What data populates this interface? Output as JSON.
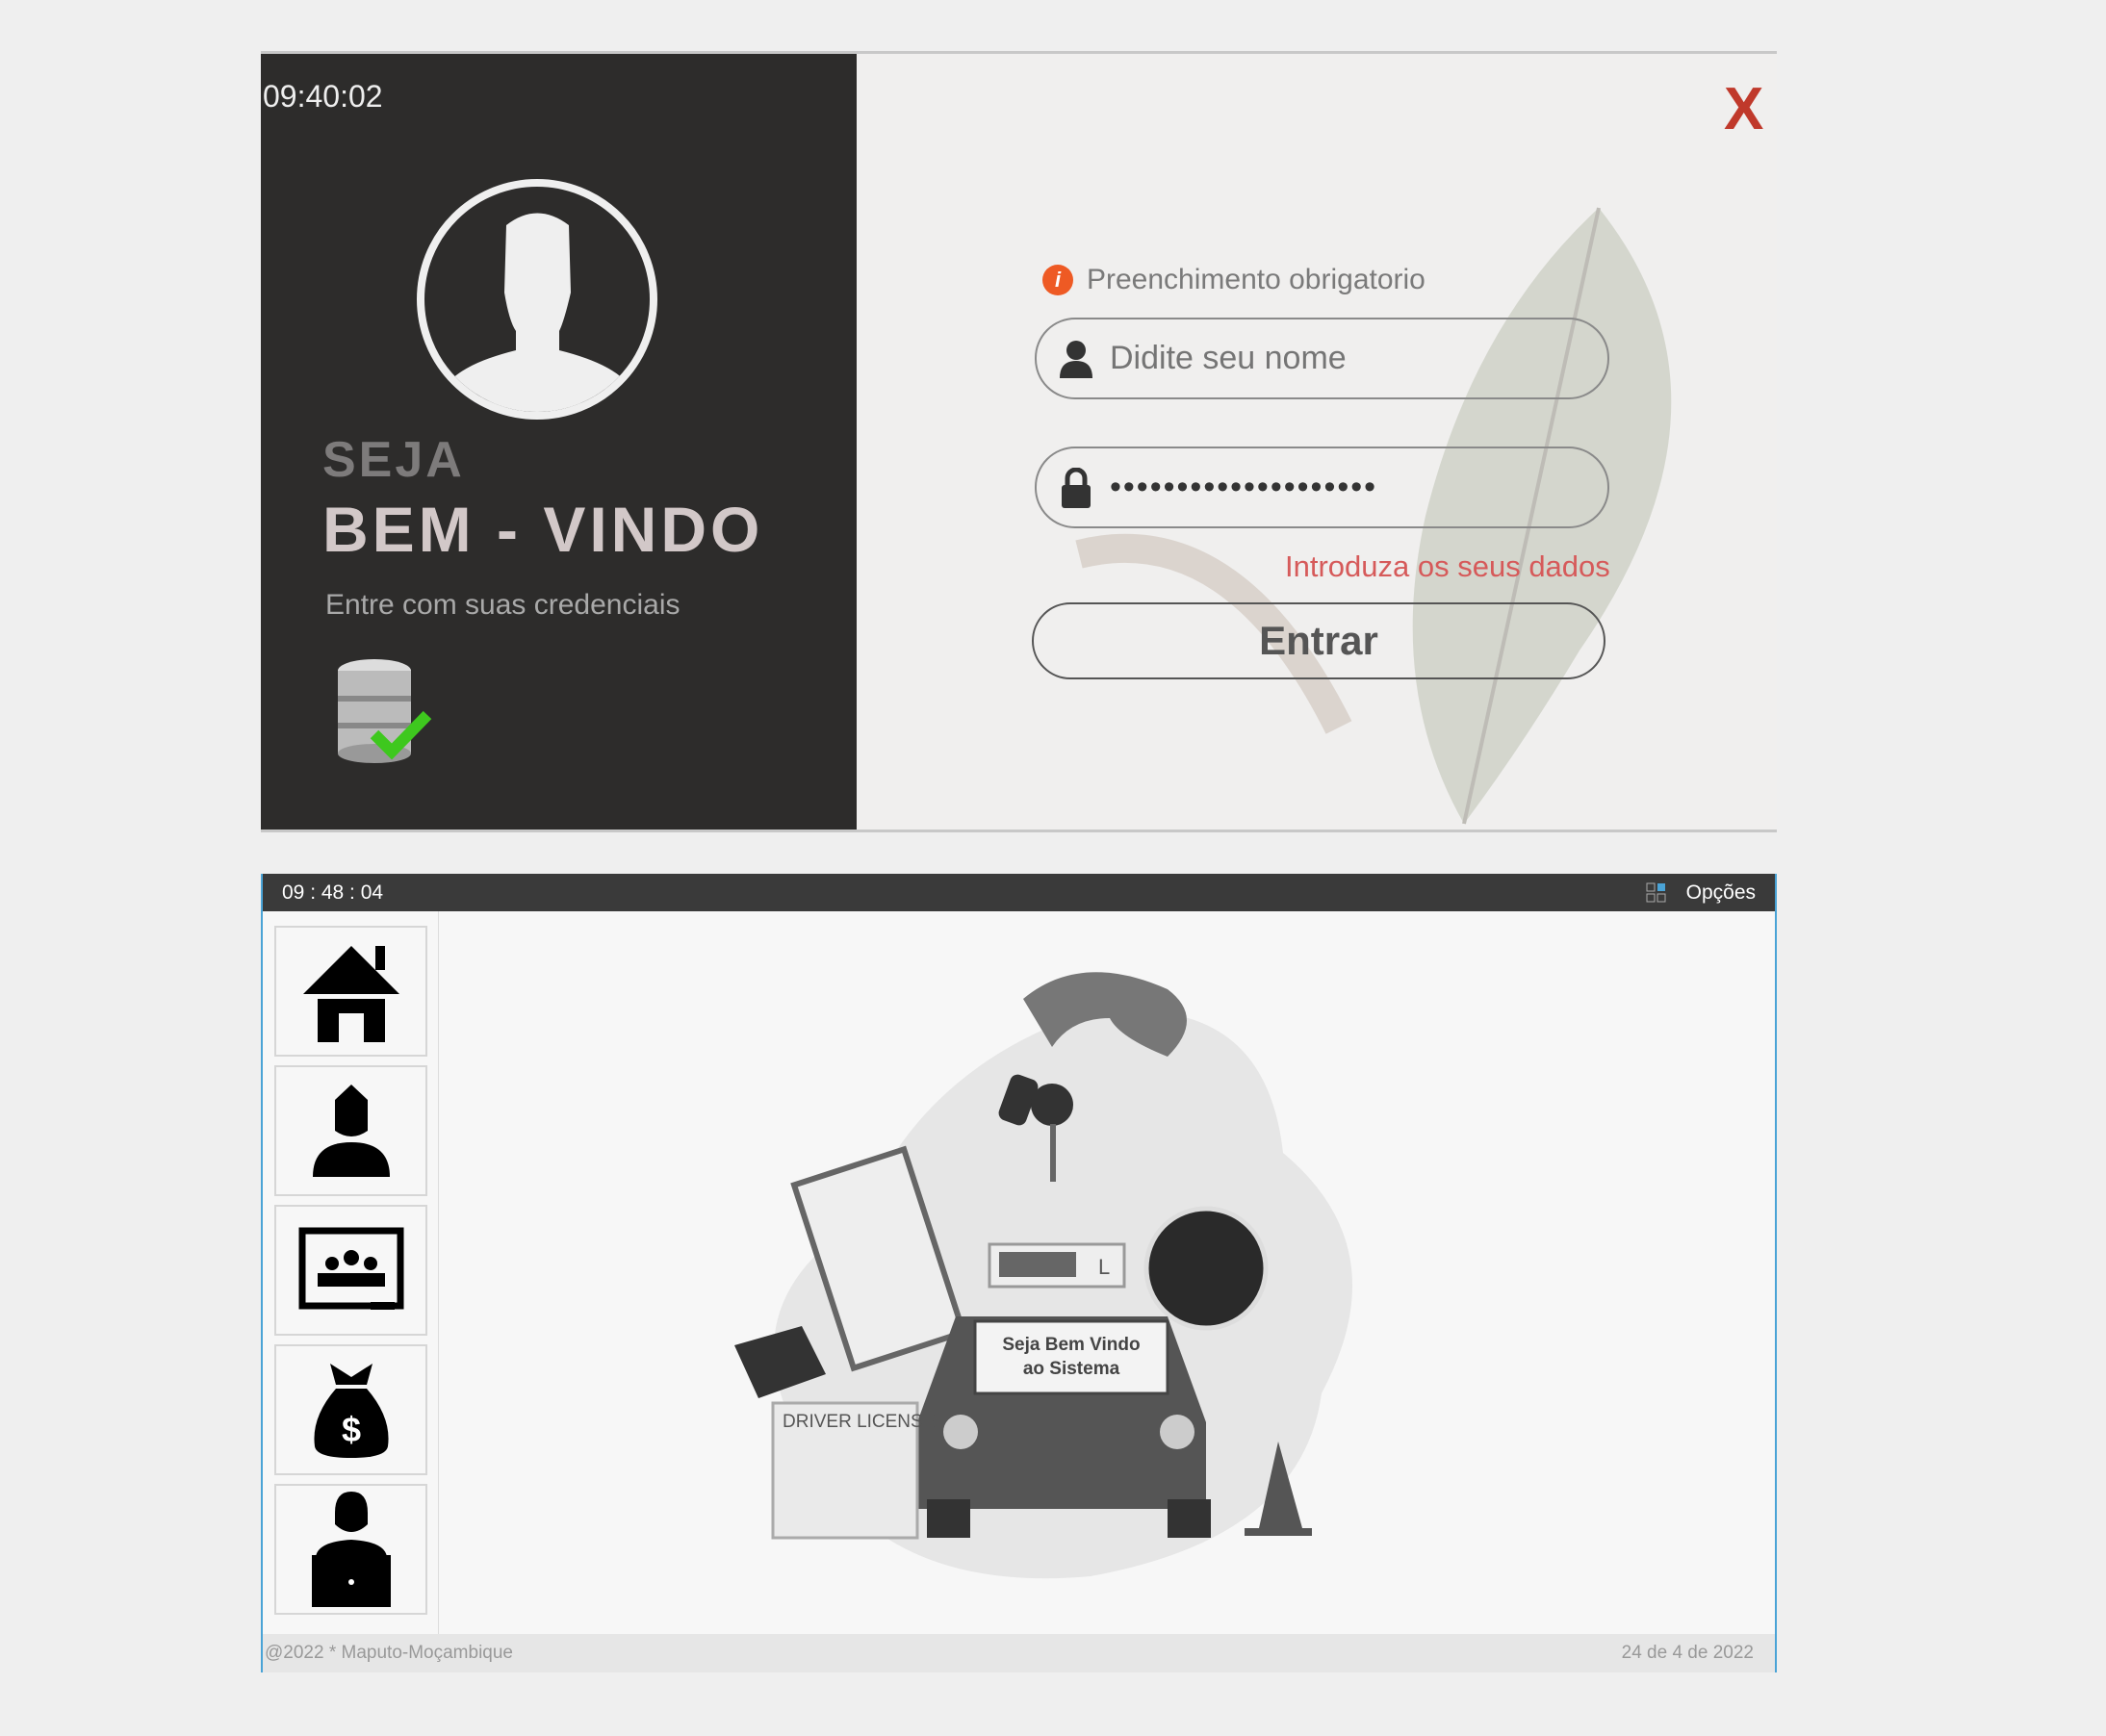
{
  "login": {
    "clock": "09:40:02",
    "welcome_line1": "SEJA",
    "welcome_line2": "BEM - VINDO",
    "subtitle": "Entre com suas credenciais",
    "close_label": "X",
    "required_hint": "Preenchimento obrigatorio",
    "username_placeholder": "Didite seu nome",
    "password_value": "••••••••••••••••••••",
    "error_message": "Introduza os seus dados",
    "submit_label": "Entrar",
    "colors": {
      "panel": "#2d2c2b",
      "close": "#c0392b",
      "error": "#d65a5a",
      "info": "#ee5a24"
    }
  },
  "main": {
    "clock": "09 : 48 : 04",
    "options_label": "Opções",
    "sidebar": [
      {
        "icon": "home-icon"
      },
      {
        "icon": "student-icon"
      },
      {
        "icon": "classroom-icon"
      },
      {
        "icon": "money-bag-icon"
      },
      {
        "icon": "employee-laptop-icon"
      }
    ],
    "banner_line1": "Seja Bem Vindo",
    "banner_line2": "ao Sistema",
    "license_text": "DRIVER LICENSE",
    "plate_letter": "L",
    "footer_left": "@2022 * Maputo-Moçambique",
    "footer_right": "24 de 4 de 2022"
  }
}
